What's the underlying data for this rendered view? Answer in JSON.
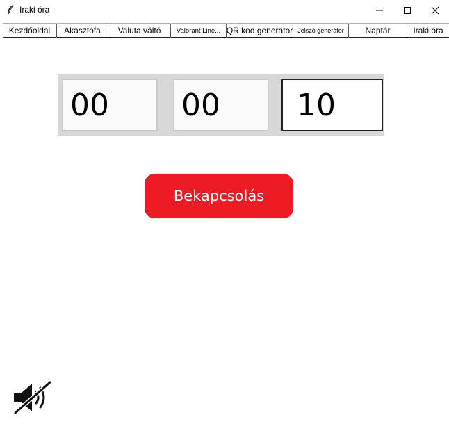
{
  "window": {
    "title": "Iraki óra",
    "controls": {
      "minimize": "—",
      "maximize": "☐",
      "close": "✕"
    }
  },
  "tabs": [
    {
      "label": "Kezdőoldal"
    },
    {
      "label": "Akasztófa"
    },
    {
      "label": "Valuta váltó"
    },
    {
      "label": "Valorant Line..."
    },
    {
      "label": "QR kod generátor"
    },
    {
      "label": "Jelszó generátor"
    },
    {
      "label": "Naptár"
    },
    {
      "label": "Iraki óra"
    }
  ],
  "timer": {
    "hours": "00",
    "minutes": "00",
    "seconds": "10"
  },
  "start_button": {
    "label": "Bekapcsolás",
    "color": "#ed1c24"
  },
  "sound": {
    "icon": "speaker-muted-icon"
  }
}
